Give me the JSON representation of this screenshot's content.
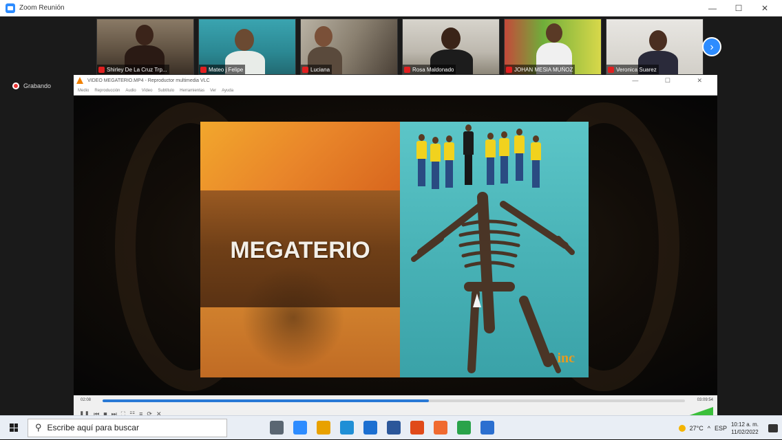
{
  "window": {
    "title": "Zoom Reunión"
  },
  "window_controls": {
    "minimize": "—",
    "maximize": "☐",
    "close": "✕"
  },
  "recording": {
    "label": "Grabando"
  },
  "participants": [
    {
      "name": "Shirley De La Cruz Trp...",
      "muted": true
    },
    {
      "name": "Mateo j Felipe",
      "muted": true
    },
    {
      "name": "Luciana",
      "muted": true
    },
    {
      "name": "Rosa Maldonado",
      "muted": true
    },
    {
      "name": "JOHAN MESIA MUÑOZ",
      "muted": true
    },
    {
      "name": "Veronica Suarez",
      "muted": true
    }
  ],
  "gallery_next_label": "›",
  "vlc": {
    "title": "VIDEO MEGATERIO.MP4 - Reproductor multimedia VLC",
    "menu": [
      "Medio",
      "Reproducción",
      "Audio",
      "Vídeo",
      "Subtítulo",
      "Herramientas",
      "Ver",
      "Ayuda"
    ],
    "window_controls": "— ☐ ✕",
    "video_title": "MEGATERIO",
    "logo": "inc",
    "time_elapsed": "02:08",
    "time_total": "03:09:54",
    "progress_fraction": 0.56,
    "controls": [
      "❚❚",
      "⏮",
      "■",
      "⏭",
      "⛶",
      "☷",
      "≡",
      "⟳",
      "✕"
    ],
    "volume_fraction": 1.0
  },
  "taskbar": {
    "search_placeholder": "Escribe aquí para buscar",
    "weather": "27°C",
    "tray_caret": "^",
    "lang": "ESP",
    "time": "10:12 a. m.",
    "date": "11/02/2022",
    "icon_colors": [
      "#5a6672",
      "#2d8cff",
      "#e8a100",
      "#1f8fd6",
      "#1b6fd1",
      "#2b579a",
      "#e04a1a",
      "#f06a30",
      "#2aa34a",
      "#2b6fd0"
    ]
  },
  "colors": {
    "zoom_blue": "#2d8cff",
    "recording_red": "#e33333",
    "vlc_orange": "#f08000",
    "volume_green": "#3bbf3b",
    "progress_blue": "#2979d5"
  }
}
